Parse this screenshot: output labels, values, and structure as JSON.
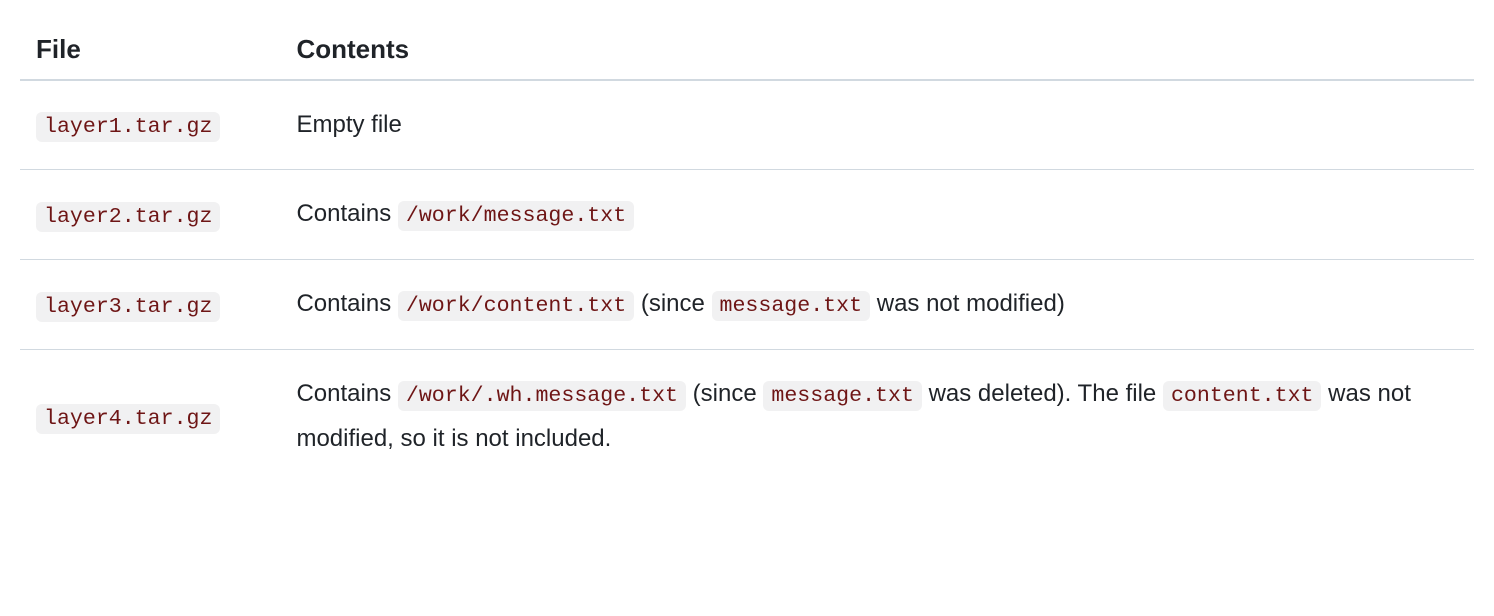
{
  "table": {
    "headers": {
      "file": "File",
      "contents": "Contents"
    },
    "rows": [
      {
        "file": "layer1.tar.gz",
        "segments": [
          {
            "t": "text",
            "v": "Empty file"
          }
        ]
      },
      {
        "file": "layer2.tar.gz",
        "segments": [
          {
            "t": "text",
            "v": "Contains "
          },
          {
            "t": "code",
            "v": "/work/message.txt"
          }
        ]
      },
      {
        "file": "layer3.tar.gz",
        "segments": [
          {
            "t": "text",
            "v": "Contains "
          },
          {
            "t": "code",
            "v": "/work/content.txt"
          },
          {
            "t": "text",
            "v": " (since "
          },
          {
            "t": "code",
            "v": "message.txt"
          },
          {
            "t": "text",
            "v": " was not modified)"
          }
        ]
      },
      {
        "file": "layer4.tar.gz",
        "segments": [
          {
            "t": "text",
            "v": "Contains "
          },
          {
            "t": "code",
            "v": "/work/.wh.message.txt"
          },
          {
            "t": "text",
            "v": " (since "
          },
          {
            "t": "code",
            "v": "message.txt"
          },
          {
            "t": "text",
            "v": " was deleted). The file "
          },
          {
            "t": "code",
            "v": "content.txt"
          },
          {
            "t": "text",
            "v": " was not modified, so it is not included."
          }
        ]
      }
    ]
  }
}
